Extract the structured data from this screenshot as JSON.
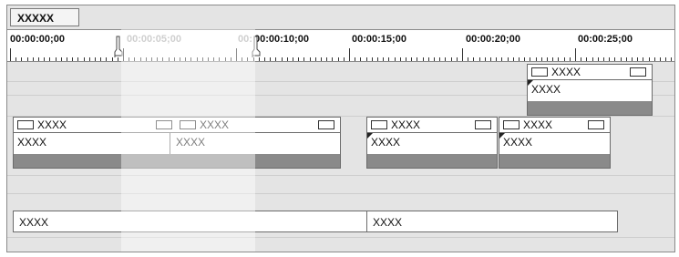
{
  "sequence_tab": "XXXXX",
  "ruler": {
    "timecodes": [
      "00:00:00;00",
      "00:00:05;00",
      "00:",
      "00:00:10;00",
      "00:00:15;00",
      "00:00:20;00",
      "00:00:25;00"
    ]
  },
  "tracks": {
    "v2": {
      "clip1": {
        "title": "XXXX",
        "name": "XXXX"
      }
    },
    "v1": {
      "clip1": {
        "title": "XXXX",
        "name": "XXXX"
      },
      "clip2": {
        "title": "XXXX",
        "name": "XXXX"
      },
      "clip3": {
        "title": "XXXX",
        "name": "XXXX"
      },
      "clip4": {
        "title": "XXXX",
        "name": "XXXX"
      }
    },
    "a1": {
      "clip1": {
        "name": "XXXX"
      },
      "clip2": {
        "name": "XXXX"
      }
    }
  },
  "colors": {
    "background": "#e4e4e4",
    "clip_bar": "#8a8a8a",
    "selection_overlay": "#f2f2f2"
  }
}
